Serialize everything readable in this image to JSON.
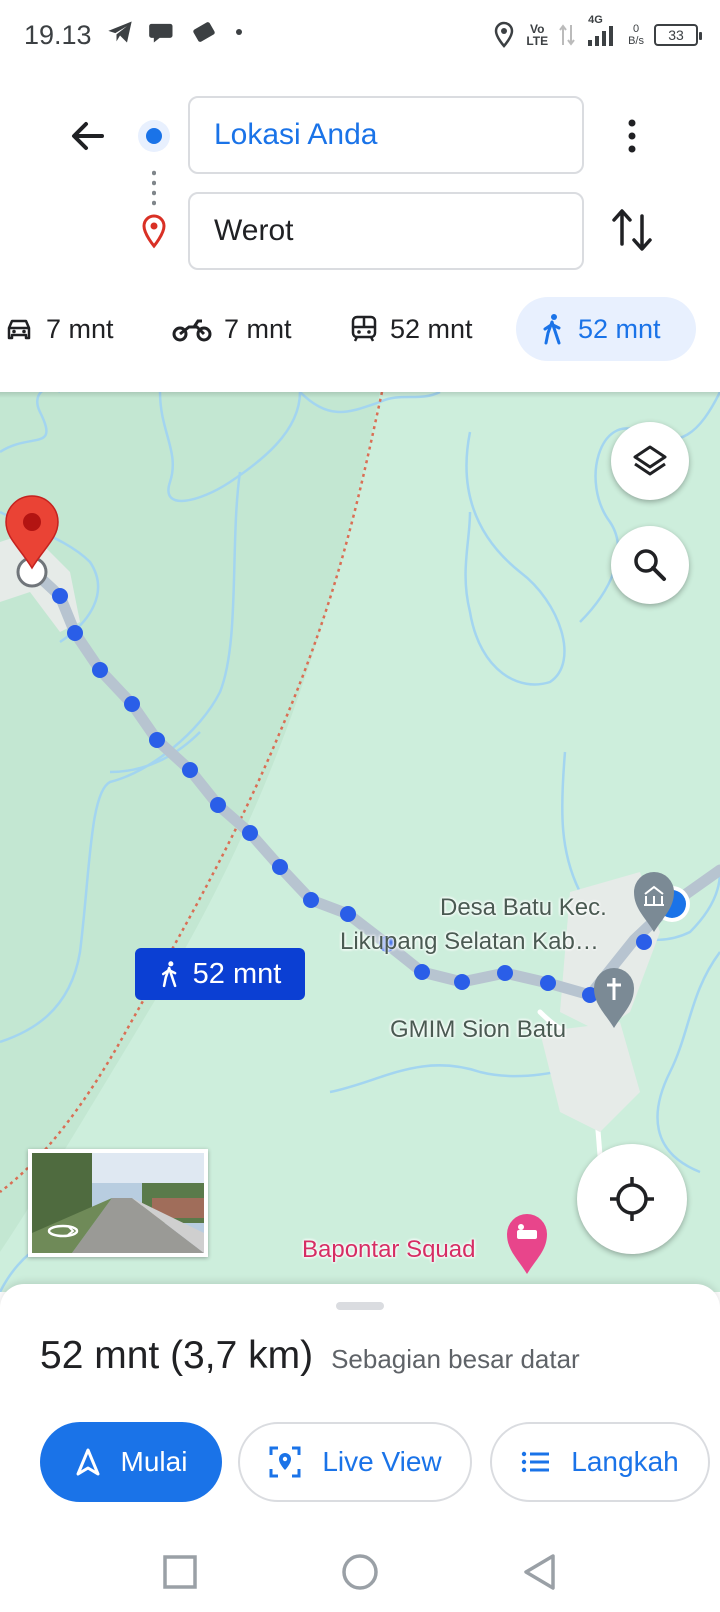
{
  "status_bar": {
    "time": "19.13",
    "volte_top": "Vo",
    "volte_bottom": "LTE",
    "network": "4G",
    "speed_top": "0",
    "speed_bottom": "B/s",
    "battery": "33"
  },
  "directions": {
    "origin": "Lokasi Anda",
    "destination": "Werot"
  },
  "modes": [
    {
      "icon": "car-icon",
      "label": "7 mnt"
    },
    {
      "icon": "motorcycle-icon",
      "label": "7 mnt"
    },
    {
      "icon": "transit-icon",
      "label": "52 mnt"
    },
    {
      "icon": "walk-icon",
      "label": "52 mnt",
      "selected": true
    }
  ],
  "map": {
    "route_label": "52 mnt",
    "labels": {
      "desa_line1": "Desa Batu Kec.",
      "desa_line2": "Likupang Selatan Kab…",
      "gmim": "GMIM Sion Batu",
      "bapontar": "Bapontar Squad"
    }
  },
  "sheet": {
    "duration_distance": "52 mnt (3,7 km)",
    "terrain": "Sebagian besar datar",
    "start_label": "Mulai",
    "live_view_label": "Live View",
    "steps_label": "Langkah"
  },
  "colors": {
    "accent": "#1a73e8",
    "route_dots": "#2a5ee8",
    "map_bg": "#cdeedc",
    "water": "#a3d5f0",
    "boundary": "#d96f55",
    "poi_pink": "#d62d64"
  }
}
